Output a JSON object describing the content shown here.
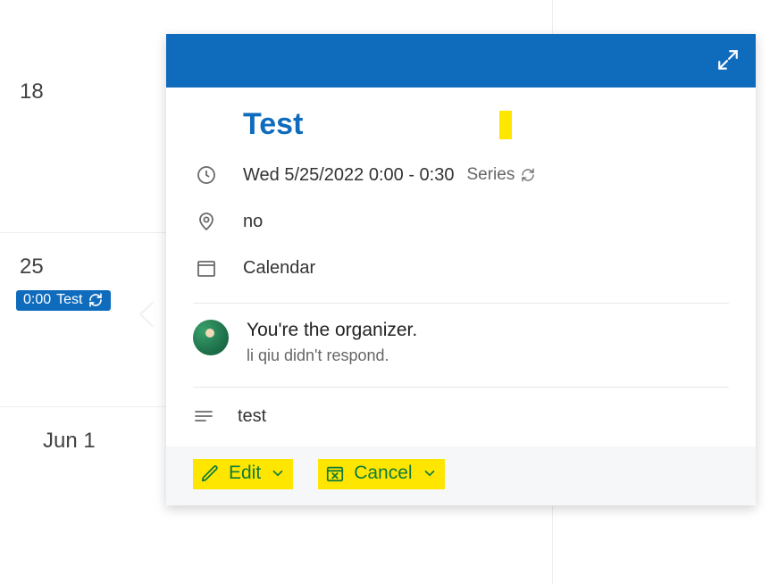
{
  "calendar": {
    "cells": {
      "c18": {
        "label": "18"
      },
      "c25": {
        "label": "25"
      },
      "c1": {
        "label": "Jun 1"
      }
    },
    "event_chip": {
      "time": "0:00",
      "title": "Test"
    }
  },
  "popover": {
    "title": "Test",
    "datetime": "Wed 5/25/2022 0:00 - 0:30",
    "series_label": "Series",
    "location": "no",
    "calendar_name": "Calendar",
    "organizer_line": "You're the organizer.",
    "response_line": "li qiu didn't respond.",
    "notes": "test",
    "actions": {
      "edit": "Edit",
      "cancel": "Cancel"
    }
  }
}
